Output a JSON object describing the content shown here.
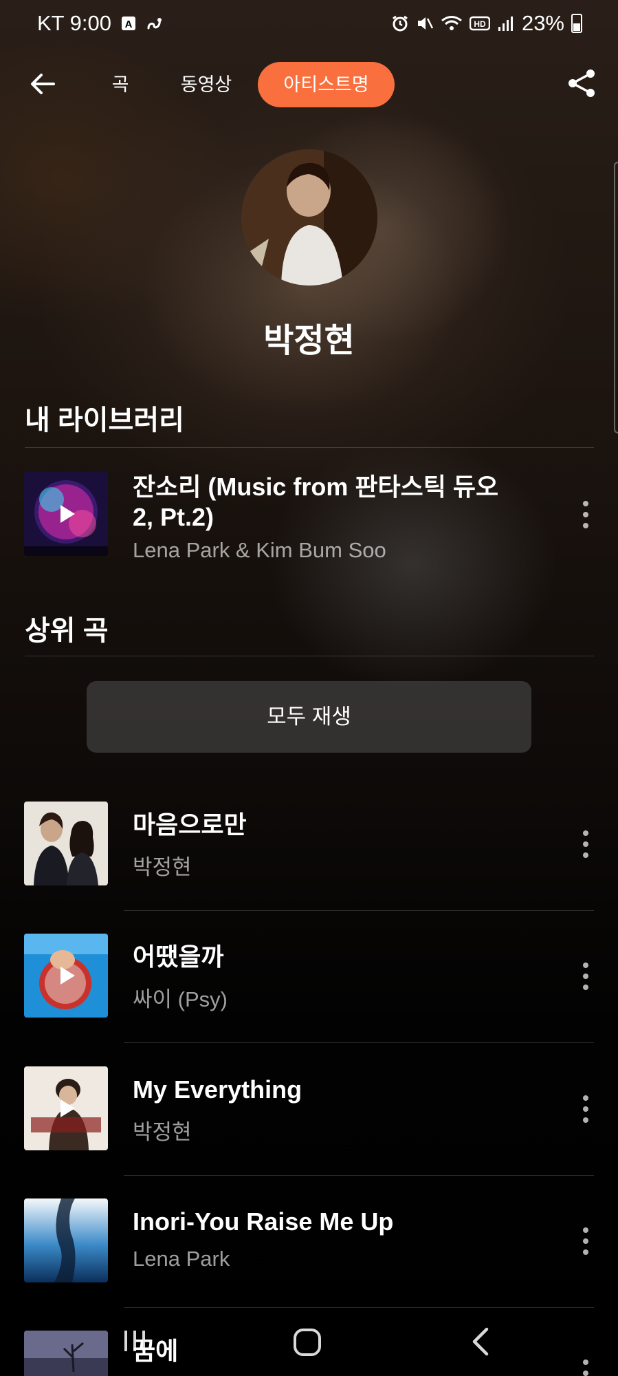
{
  "status_bar": {
    "carrier_time": "KT 9:00",
    "battery": "23%"
  },
  "nav": {
    "tab_song": "곡",
    "tab_video": "동영상",
    "tab_artist": "아티스트명",
    "active_tab": "아티스트명",
    "accent_color": "#f9703e"
  },
  "artist": {
    "name": "박정현"
  },
  "library": {
    "title": "내 라이브러리",
    "items": [
      {
        "title": "잔소리 (Music from 판타스틱 듀오 2, Pt.2)",
        "artist": "Lena Park & Kim Bum Soo"
      }
    ]
  },
  "top_songs": {
    "title": "상위 곡",
    "play_all": "모두 재생",
    "items": [
      {
        "title": "마음으로만",
        "artist": "박정현"
      },
      {
        "title": "어땠을까",
        "artist": "싸이 (Psy)"
      },
      {
        "title": "My Everything",
        "artist": "박정현"
      },
      {
        "title": "Inori-You Raise Me Up",
        "artist": "Lena Park"
      },
      {
        "title": "꿈에",
        "artist": ""
      }
    ]
  }
}
